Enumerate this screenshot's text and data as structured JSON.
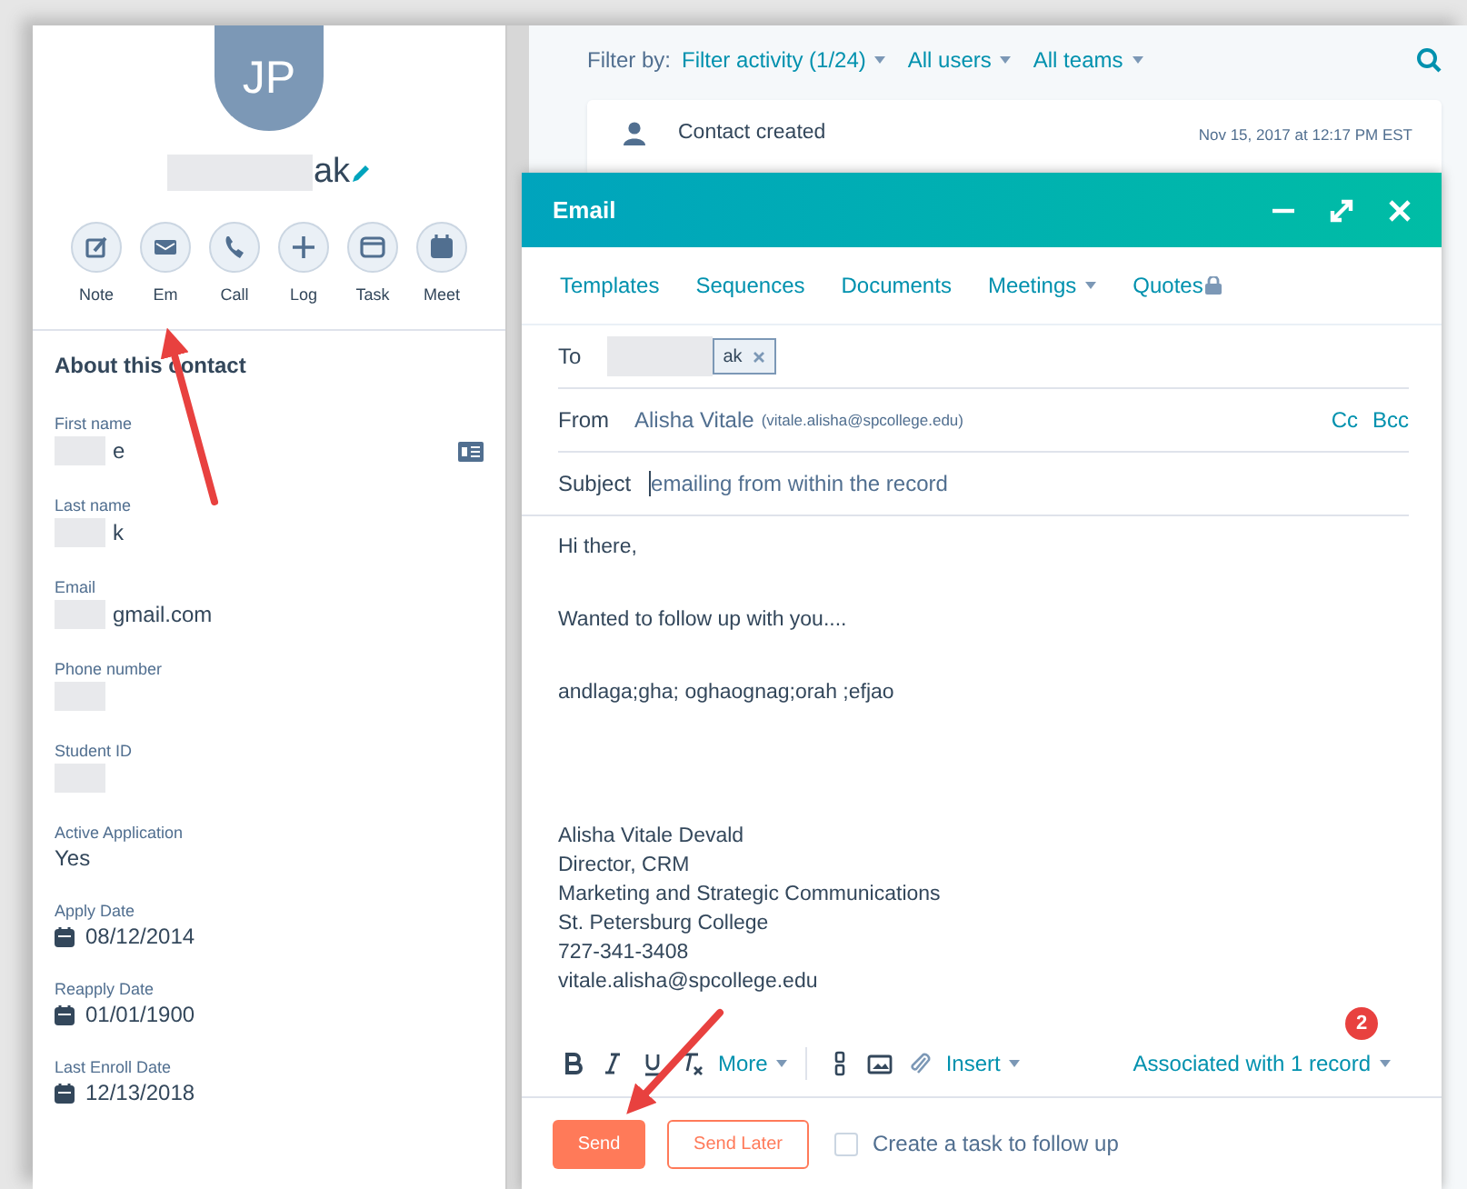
{
  "contact": {
    "initials": "JP",
    "name": "ak"
  },
  "actions": [
    {
      "kind": "note",
      "label": "Note"
    },
    {
      "kind": "email",
      "label": "Em"
    },
    {
      "kind": "call",
      "label": "Call"
    },
    {
      "kind": "log",
      "label": "Log"
    },
    {
      "kind": "task",
      "label": "Task"
    },
    {
      "kind": "meet",
      "label": "Meet"
    }
  ],
  "about": {
    "title": "About this contact",
    "properties": [
      {
        "kind": "card",
        "label": "First name",
        "value": "e",
        "redacted": true
      },
      {
        "kind": "text",
        "label": "Last name",
        "value": "k",
        "redacted": true
      },
      {
        "kind": "text",
        "label": "Email",
        "value": "gmail.com",
        "redacted": true
      },
      {
        "kind": "text",
        "label": "Phone number",
        "redacted": true
      },
      {
        "kind": "text",
        "label": "Student ID",
        "redacted": true
      },
      {
        "kind": "text",
        "label": "Active Application",
        "value": "Yes",
        "redacted": false
      },
      {
        "kind": "date",
        "label": "Apply Date",
        "value": "08/12/2014",
        "redacted": false
      },
      {
        "kind": "date",
        "label": "Reapply Date",
        "value": "01/01/1900",
        "redacted": false
      },
      {
        "kind": "date",
        "label": "Last Enroll Date",
        "value": "12/13/2018",
        "redacted": false
      }
    ]
  },
  "filter_bar": {
    "label": "Filter by:",
    "filters": [
      "Filter activity (1/24)",
      "All users",
      "All teams"
    ]
  },
  "timeline": [
    {
      "title": "Contact created",
      "time": "Nov 15, 2017 at 12:17 PM EST"
    }
  ],
  "email": {
    "title": "Email",
    "tools": [
      {
        "label": "Templates",
        "dropdown": false,
        "locked": false
      },
      {
        "label": "Sequences",
        "dropdown": false,
        "locked": false
      },
      {
        "label": "Documents",
        "dropdown": false,
        "locked": false
      },
      {
        "label": "Meetings",
        "dropdown": true,
        "locked": false
      },
      {
        "label": "Quotes",
        "dropdown": false,
        "locked": true
      }
    ],
    "to": {
      "label": "To",
      "recipient": "ak",
      "redacted": true
    },
    "from": {
      "label": "From",
      "name": "Alisha Vitale",
      "address": "(vitale.alisha@spcollege.edu)"
    },
    "cc": "Cc",
    "bcc": "Bcc",
    "subject": {
      "label": "Subject",
      "value": "emailing from within the record"
    },
    "body": [
      "Hi there,",
      "Wanted to follow up with you....",
      "andlaga;gha; oghaognag;orah ;efjao"
    ],
    "signature": [
      "Alisha Vitale Devald",
      "Director, CRM",
      "Marketing and Strategic Communications",
      "St. Petersburg College",
      "727-341-3408",
      "vitale.alisha@spcollege.edu"
    ],
    "badge": "2",
    "format": {
      "more": "More",
      "insert": "Insert"
    },
    "associated": "Associated with 1 record",
    "send": "Send",
    "send_later": "Send Later",
    "task": {
      "label": "Create a task to follow up",
      "checked": false
    }
  }
}
